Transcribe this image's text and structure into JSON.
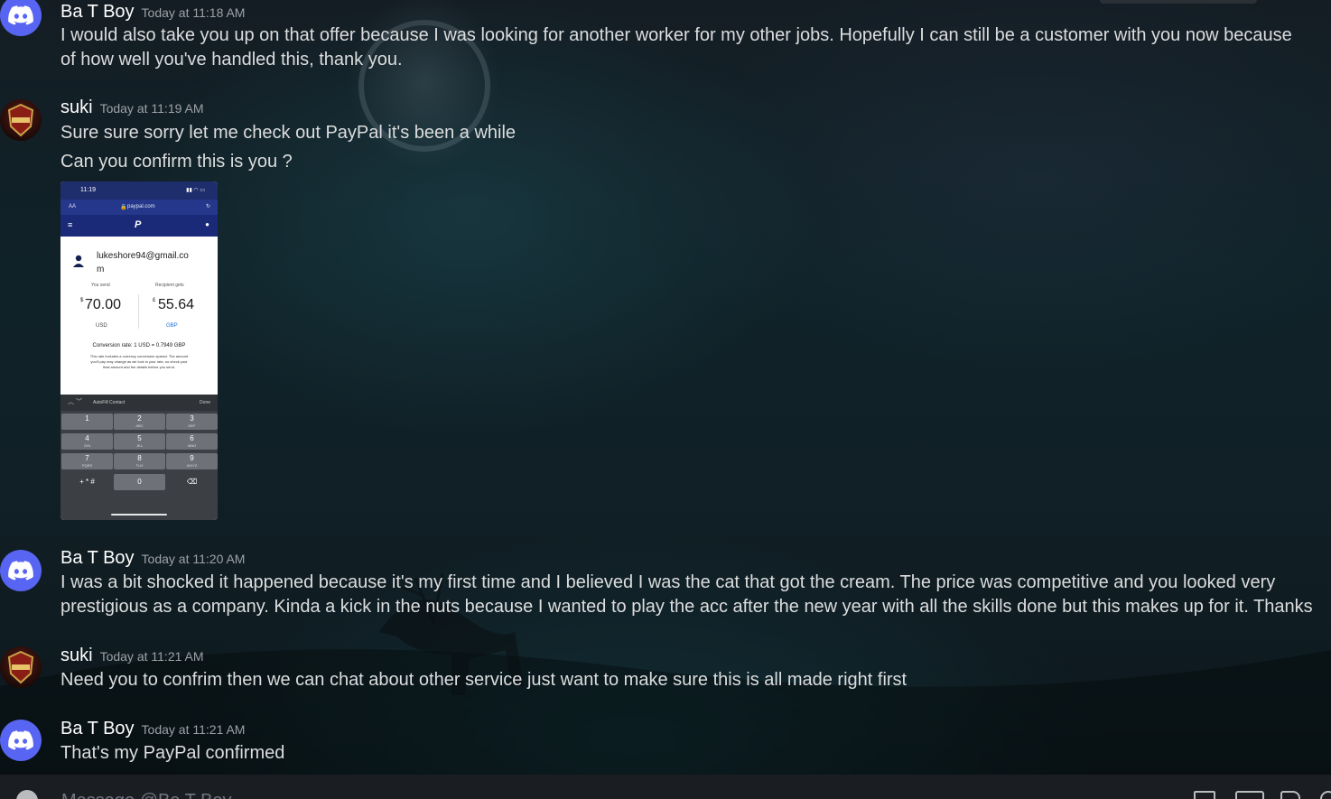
{
  "prev_message": {
    "username": "Ba T Boy",
    "timestamp": "Today at 11:18 AM",
    "line1": "I would also take you up on that offer because I was looking for another worker for my other jobs. Hopefully I can still be a customer with you now because",
    "line2": "of how well you've handled this, thank you."
  },
  "messages": [
    {
      "username": "suki",
      "timestamp": "Today at 11:19 AM",
      "lines": [
        "Sure sure sorry let me check out PayPal it's been a while",
        "Can you confirm this is you ?"
      ]
    },
    {
      "username": "Ba T Boy",
      "timestamp": "Today at 11:20 AM",
      "lines": [
        "I was a bit shocked it happened because it's my first time and I believed I was the cat that got the cream. The price was competitive and you looked very",
        "prestigious as a company. Kinda a kick in the nuts because I wanted to play the acc after the new year with all the skills done but this makes up for it. Thanks"
      ]
    },
    {
      "username": "suki",
      "timestamp": "Today at 11:21 AM",
      "lines": [
        "Need you to confrim then we can chat about other service just want to make sure this is all made right first"
      ]
    },
    {
      "username": "Ba T Boy",
      "timestamp": "Today at 11:21 AM",
      "lines": [
        "That's my PayPal confirmed"
      ]
    }
  ],
  "attachment": {
    "status_time": "11:19",
    "url_prefix": "AA",
    "url": "paypal.com",
    "email_line1": "lukeshore94@gmail.co",
    "email_line2": "m",
    "you_send_label": "You send",
    "recipient_label": "Recipient gets",
    "send_symbol": "$",
    "send_amount": "70.00",
    "send_currency": "USD",
    "recv_symbol": "£",
    "recv_amount": "55.64",
    "recv_currency": "GBP",
    "rate": "Conversion rate: 1 USD = 0.7949 GBP",
    "disclaimer1": "This rate includes a currency conversion spread. The amount",
    "disclaimer2": "you'll pay may change as we lock in your rate, so check your",
    "disclaimer3": "final amount and fee details before you send.",
    "autofill": "AutoFill Contact",
    "done": "Done",
    "keys": [
      {
        "num": "1",
        "letters": ""
      },
      {
        "num": "2",
        "letters": "ABC"
      },
      {
        "num": "3",
        "letters": "DEF"
      },
      {
        "num": "4",
        "letters": "GHI"
      },
      {
        "num": "5",
        "letters": "JKL"
      },
      {
        "num": "6",
        "letters": "MNO"
      },
      {
        "num": "7",
        "letters": "PQRS"
      },
      {
        "num": "8",
        "letters": "TUV"
      },
      {
        "num": "9",
        "letters": "WXYZ"
      }
    ],
    "key_symbols": "+ * #",
    "key_zero": "0"
  },
  "composer": {
    "placeholder": "Message @Ba T Boy"
  },
  "colors": {
    "discord_blurple": "#5865f2",
    "paypal_navy": "#1a2a78"
  },
  "icons": [
    "discord-logo-icon",
    "add-icon",
    "gift-icon",
    "gif-icon",
    "sticker-icon"
  ]
}
